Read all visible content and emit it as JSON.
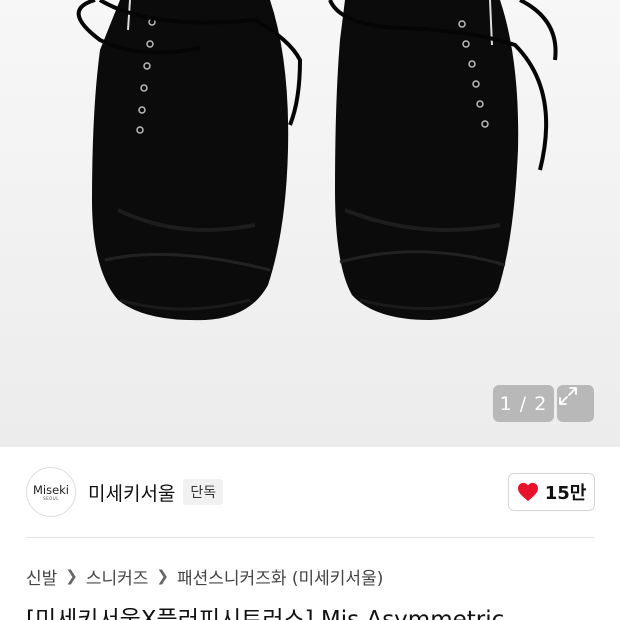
{
  "gallery": {
    "current": "1",
    "total": "2",
    "separator": "/",
    "pager_text": "1 / 2",
    "expand_icon": "expand-icon"
  },
  "brand": {
    "logo_line1": "Miseki",
    "logo_line2": "SEOUL",
    "name": "미세키서울",
    "badge": "단독"
  },
  "like": {
    "icon": "heart-icon",
    "count": "15만",
    "color": "#e8132b"
  },
  "breadcrumb": {
    "items": [
      "신발",
      "스니커즈",
      "패션스니커즈화 (미세키서울)"
    ]
  },
  "product": {
    "title": "[미세키서울X플러피시트러스] Mis Asymmetric"
  }
}
